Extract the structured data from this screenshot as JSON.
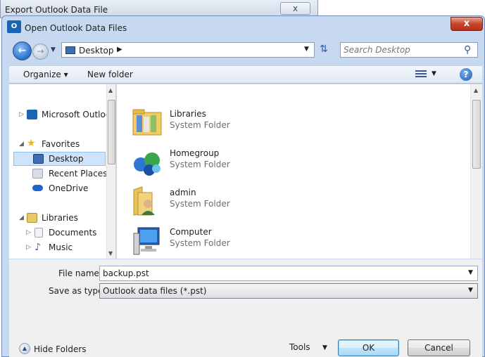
{
  "background_window": {
    "title": "Export Outlook Data File",
    "close": "x"
  },
  "dialog": {
    "title": "Open Outlook Data Files",
    "close": "x"
  },
  "address_bar": {
    "location": "Desktop",
    "search_placeholder": "Search Desktop"
  },
  "toolbar": {
    "organize": "Organize",
    "new_folder": "New folder"
  },
  "nav_pane": {
    "items": [
      {
        "label": "Microsoft Outloo"
      },
      {
        "label": "Favorites"
      },
      {
        "label": "Desktop"
      },
      {
        "label": "Recent Places"
      },
      {
        "label": "OneDrive"
      },
      {
        "label": "Libraries"
      },
      {
        "label": "Documents"
      },
      {
        "label": "Music"
      }
    ]
  },
  "files": [
    {
      "name": "Libraries",
      "type": "System Folder"
    },
    {
      "name": "Homegroup",
      "type": "System Folder"
    },
    {
      "name": "admin",
      "type": "System Folder"
    },
    {
      "name": "Computer",
      "type": "System Folder"
    }
  ],
  "form": {
    "file_name_label": "File name:",
    "file_name_value": "backup.pst",
    "save_type_label": "Save as type:",
    "save_type_value": "Outlook data files (*.pst)"
  },
  "footer": {
    "hide_folders": "Hide Folders",
    "tools": "Tools",
    "ok": "OK",
    "cancel": "Cancel"
  },
  "colors": {
    "accent": "#1a63b5",
    "selection": "#cde4fb",
    "close_red": "#c7452a"
  }
}
